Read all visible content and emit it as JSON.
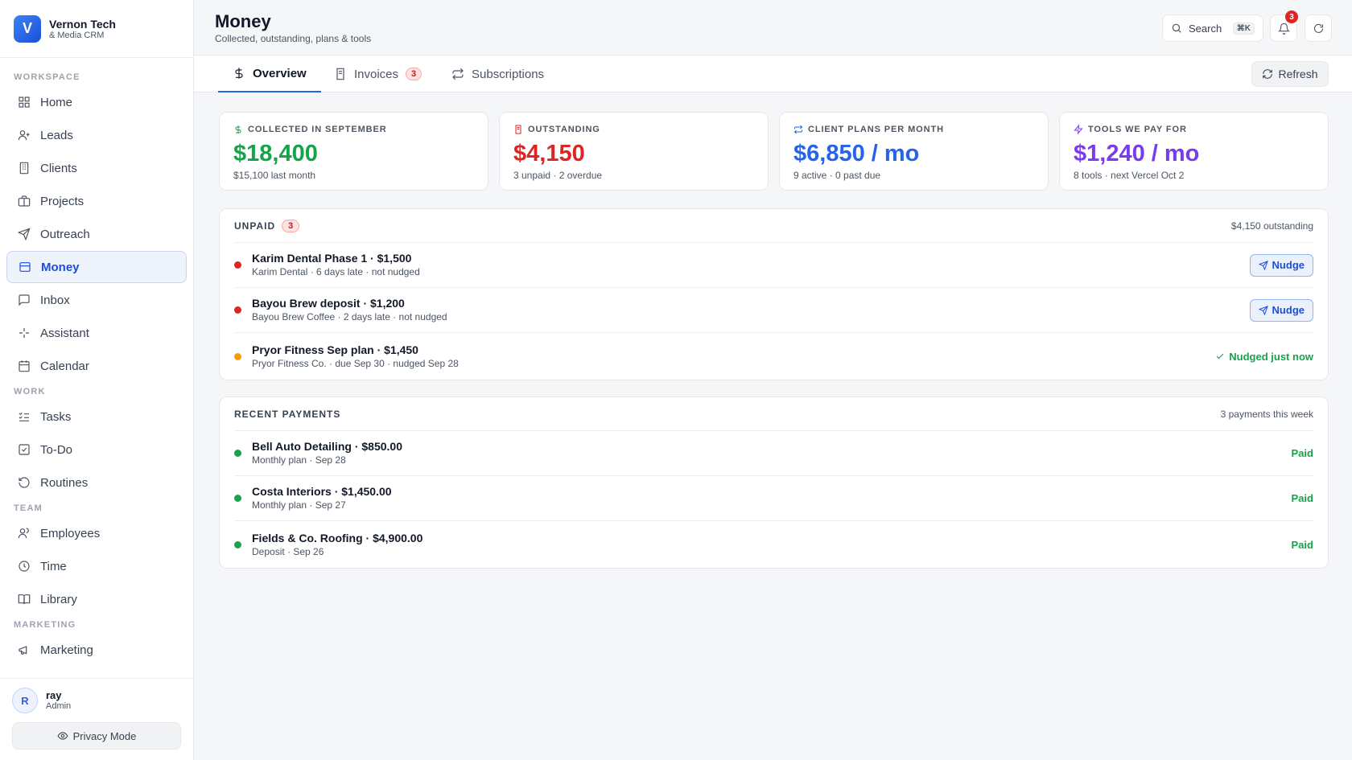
{
  "brand": {
    "logo_letter": "V",
    "name": "Vernon Tech",
    "sub": "& Media CRM"
  },
  "sidebar": {
    "sections": [
      {
        "title": "WORKSPACE",
        "items": [
          {
            "label": "Home",
            "icon": "grid-icon"
          },
          {
            "label": "Leads",
            "icon": "user-plus-icon"
          },
          {
            "label": "Clients",
            "icon": "building-icon"
          },
          {
            "label": "Projects",
            "icon": "briefcase-icon"
          },
          {
            "label": "Outreach",
            "icon": "send-icon"
          },
          {
            "label": "Money",
            "icon": "wallet-icon",
            "active": true
          },
          {
            "label": "Inbox",
            "icon": "message-icon"
          },
          {
            "label": "Assistant",
            "icon": "sparkle-icon"
          },
          {
            "label": "Calendar",
            "icon": "calendar-icon"
          }
        ]
      },
      {
        "title": "WORK",
        "items": [
          {
            "label": "Tasks",
            "icon": "list-checks-icon"
          },
          {
            "label": "To-Do",
            "icon": "checkbox-icon"
          },
          {
            "label": "Routines",
            "icon": "rotate-ccw-icon"
          }
        ]
      },
      {
        "title": "TEAM",
        "items": [
          {
            "label": "Employees",
            "icon": "users-icon"
          },
          {
            "label": "Time",
            "icon": "clock-icon"
          },
          {
            "label": "Library",
            "icon": "book-icon"
          }
        ]
      },
      {
        "title": "MARKETING",
        "items": [
          {
            "label": "Marketing",
            "icon": "megaphone-icon"
          }
        ]
      }
    ]
  },
  "user": {
    "initial": "R",
    "name": "ray",
    "role": "Admin"
  },
  "privacy_label": "Privacy Mode",
  "header": {
    "title": "Money",
    "subtitle": "Collected, outstanding, plans & tools",
    "search_label": "Search",
    "search_kbd": "⌘K",
    "notifications_count": "3"
  },
  "tabs": [
    {
      "label": "Overview",
      "icon": "dollar-icon",
      "active": true
    },
    {
      "label": "Invoices",
      "icon": "receipt-icon",
      "count": "3"
    },
    {
      "label": "Subscriptions",
      "icon": "repeat-icon"
    }
  ],
  "refresh_label": "Refresh",
  "stats": [
    {
      "label": "COLLECTED IN SEPTEMBER",
      "value": "$18,400",
      "sub": "$15,100 last month",
      "color": "#16a34a",
      "icon": "dollar-icon"
    },
    {
      "label": "OUTSTANDING",
      "value": "$4,150",
      "sub": "3 unpaid · 2 overdue",
      "color": "#dc2626",
      "icon": "receipt-icon"
    },
    {
      "label": "CLIENT PLANS PER MONTH",
      "value": "$6,850 / mo",
      "sub": "9 active · 0 past due",
      "color": "#2563eb",
      "icon": "repeat-icon"
    },
    {
      "label": "TOOLS WE PAY FOR",
      "value": "$1,240 / mo",
      "sub": "8 tools · next Vercel Oct 2",
      "color": "#7c3aed",
      "icon": "zap-icon"
    }
  ],
  "unpaid": {
    "title": "UNPAID",
    "count": "3",
    "summary": "$4,150 outstanding",
    "nudge_label": "Nudge",
    "rows": [
      {
        "title": "Karim Dental Phase 1 · $1,500",
        "sub": "Karim Dental · 6 days late · not nudged",
        "status": "overdue",
        "dot": "#dc2626",
        "action": "nudge"
      },
      {
        "title": "Bayou Brew deposit · $1,200",
        "sub": "Bayou Brew Coffee · 2 days late · not nudged",
        "status": "overdue",
        "dot": "#dc2626",
        "action": "nudge"
      },
      {
        "title": "Pryor Fitness Sep plan · $1,450",
        "sub": "Pryor Fitness Co. · due Sep 30 · nudged Sep 28",
        "status": "due",
        "dot": "#f59e0b",
        "action": "nudged",
        "action_label": "Nudged just now"
      }
    ]
  },
  "payments": {
    "title": "RECENT PAYMENTS",
    "summary": "3 payments this week",
    "rows": [
      {
        "title": "Bell Auto Detailing · $850.00",
        "sub": "Monthly plan · Sep 28",
        "status": "Paid",
        "dot": "#16a34a"
      },
      {
        "title": "Costa Interiors · $1,450.00",
        "sub": "Monthly plan · Sep 27",
        "status": "Paid",
        "dot": "#16a34a"
      },
      {
        "title": "Fields & Co. Roofing · $4,900.00",
        "sub": "Deposit · Sep 26",
        "status": "Paid",
        "dot": "#16a34a"
      }
    ]
  }
}
